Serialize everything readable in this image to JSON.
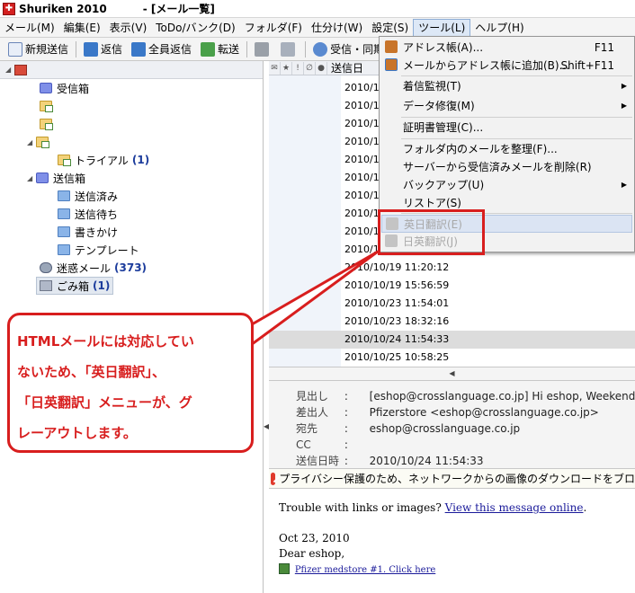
{
  "window": {
    "app_name": "Shuriken 2010",
    "doc_title": "- [メール一覧]"
  },
  "menubar": {
    "items": [
      "メール(M)",
      "編集(E)",
      "表示(V)",
      "ToDo/バンク(D)",
      "フォルダ(F)",
      "仕分け(W)",
      "設定(S)",
      "ツール(L)",
      "ヘルプ(H)"
    ],
    "active_index": 7
  },
  "toolbar": {
    "new_label": "新規送信",
    "reply_label": "返信",
    "reply_all_label": "全員返信",
    "forward_label": "転送",
    "sync_label": "受信・同期"
  },
  "folders": {
    "inbox": "受信箱",
    "trial": "トライアル",
    "trial_count": "(1)",
    "sent_box": "送信箱",
    "sent_done": "送信済み",
    "sent_wait": "送信待ち",
    "drafts": "書きかけ",
    "templates": "テンプレート",
    "spam": "迷惑メール",
    "spam_count": "(373)",
    "trash": "ごみ箱",
    "trash_count": "(1)"
  },
  "message_list": {
    "date_header": "送信日",
    "rows": [
      "2010/1",
      "2010/1",
      "2010/1",
      "2010/1",
      "2010/1",
      "2010/1",
      "2010/1",
      "2010/1",
      "2010/1",
      "2010/1",
      "2010/10/19 11:20:12",
      "2010/10/19 15:56:59",
      "2010/10/23 11:54:01",
      "2010/10/23 18:32:16",
      "2010/10/24 11:54:33",
      "2010/10/25 10:58:25"
    ],
    "selected_index": 14
  },
  "tools_menu": {
    "address_book": "アドレス帳(A)...",
    "address_book_shortcut": "F11",
    "add_from_mail": "メールからアドレス帳に追加(B)...",
    "add_from_mail_shortcut": "Shift+F11",
    "incoming_monitor": "着信監視(T)",
    "data_repair": "データ修復(M)",
    "cert_manager": "証明書管理(C)...",
    "organize": "フォルダ内のメールを整理(F)...",
    "delete_server": "サーバーから受信済みメールを削除(R)",
    "backup": "バックアップ(U)",
    "restore": "リストア(S)",
    "en_ja": "英日翻訳(E)",
    "ja_en": "日英翻訳(J)"
  },
  "preview": {
    "subject_label": "見出し",
    "subject": "[eshop@crosslanguage.co.jp] Hi eshop, Weekend sale",
    "from_label": "差出人",
    "from": "Pfizerstore <eshop@crosslanguage.co.jp>",
    "to_label": "宛先",
    "to": "eshop@crosslanguage.co.jp",
    "cc_label": "CC",
    "cc": "",
    "date_label": "送信日時",
    "date": "2010/10/24 11:54:33",
    "colon": ":",
    "privacy_notice": "プライバシー保護のため、ネットワークからの画像のダウンロードをブロ",
    "body_line1": "Trouble with links or images?",
    "body_link1": "View this message online",
    "body_date": "Oct 23, 2010",
    "body_greeting": "Dear  eshop,",
    "body_link2": "Pfizer medstore #1. Click here"
  },
  "annotation": {
    "line1": "HTMLメールには対応してい",
    "line2": "ないため、「英日翻訳」、",
    "line3": "「日英翻訳」メニューが、グ",
    "line4": "レーアウトします。",
    "color": "#d81e1e"
  }
}
